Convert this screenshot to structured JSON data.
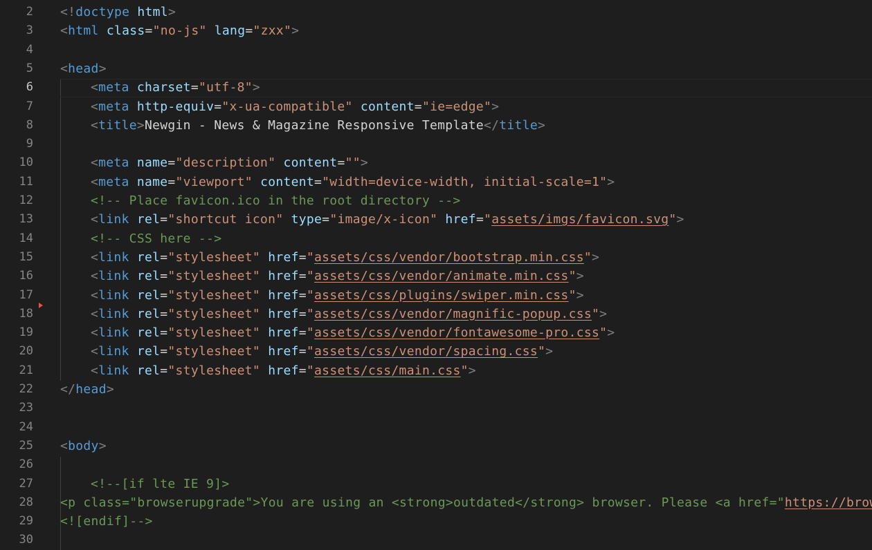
{
  "editor": {
    "theme_colors": {
      "background": "#1e1e1e",
      "line_number": "#858585",
      "tag": "#569cd6",
      "attribute": "#9cdcfe",
      "string": "#ce9178",
      "comment": "#6a9955",
      "text": "#d4d4d4",
      "punctuation": "#808080"
    },
    "active_line": 6,
    "lines": [
      {
        "n": "2",
        "indent": 0,
        "tokens": [
          [
            "p",
            "<!"
          ],
          [
            "t",
            "doctype"
          ],
          [
            "x",
            " "
          ],
          [
            "a",
            "html"
          ],
          [
            "p",
            ">"
          ]
        ]
      },
      {
        "n": "3",
        "indent": 0,
        "tokens": [
          [
            "p",
            "<"
          ],
          [
            "t",
            "html"
          ],
          [
            "x",
            " "
          ],
          [
            "a",
            "class"
          ],
          [
            "x",
            "="
          ],
          [
            "s",
            "\"no-js\""
          ],
          [
            "x",
            " "
          ],
          [
            "a",
            "lang"
          ],
          [
            "x",
            "="
          ],
          [
            "s",
            "\"zxx\""
          ],
          [
            "p",
            ">"
          ]
        ]
      },
      {
        "n": "4",
        "indent": 0,
        "tokens": []
      },
      {
        "n": "5",
        "indent": 0,
        "tokens": [
          [
            "p",
            "<"
          ],
          [
            "t",
            "head"
          ],
          [
            "p",
            ">"
          ]
        ]
      },
      {
        "n": "6",
        "indent": 1,
        "tokens": [
          [
            "p",
            "<"
          ],
          [
            "t",
            "meta"
          ],
          [
            "x",
            " "
          ],
          [
            "a",
            "charset"
          ],
          [
            "x",
            "="
          ],
          [
            "s",
            "\"utf-8\""
          ],
          [
            "p",
            ">"
          ]
        ]
      },
      {
        "n": "7",
        "indent": 1,
        "tokens": [
          [
            "p",
            "<"
          ],
          [
            "t",
            "meta"
          ],
          [
            "x",
            " "
          ],
          [
            "a",
            "http-equiv"
          ],
          [
            "x",
            "="
          ],
          [
            "s",
            "\"x-ua-compatible\""
          ],
          [
            "x",
            " "
          ],
          [
            "a",
            "content"
          ],
          [
            "x",
            "="
          ],
          [
            "s",
            "\"ie=edge\""
          ],
          [
            "p",
            ">"
          ]
        ]
      },
      {
        "n": "8",
        "indent": 1,
        "tokens": [
          [
            "p",
            "<"
          ],
          [
            "t",
            "title"
          ],
          [
            "p",
            ">"
          ],
          [
            "x",
            "Newgin - News & Magazine Responsive Template"
          ],
          [
            "p",
            "</"
          ],
          [
            "t",
            "title"
          ],
          [
            "p",
            ">"
          ]
        ]
      },
      {
        "n": "9",
        "indent": 1,
        "tokens": []
      },
      {
        "n": "10",
        "indent": 1,
        "tokens": [
          [
            "p",
            "<"
          ],
          [
            "t",
            "meta"
          ],
          [
            "x",
            " "
          ],
          [
            "a",
            "name"
          ],
          [
            "x",
            "="
          ],
          [
            "s",
            "\"description\""
          ],
          [
            "x",
            " "
          ],
          [
            "a",
            "content"
          ],
          [
            "x",
            "="
          ],
          [
            "s",
            "\"\""
          ],
          [
            "p",
            ">"
          ]
        ]
      },
      {
        "n": "11",
        "indent": 1,
        "tokens": [
          [
            "p",
            "<"
          ],
          [
            "t",
            "meta"
          ],
          [
            "x",
            " "
          ],
          [
            "a",
            "name"
          ],
          [
            "x",
            "="
          ],
          [
            "s",
            "\"viewport\""
          ],
          [
            "x",
            " "
          ],
          [
            "a",
            "content"
          ],
          [
            "x",
            "="
          ],
          [
            "s",
            "\"width=device-width, initial-scale=1\""
          ],
          [
            "p",
            ">"
          ]
        ]
      },
      {
        "n": "12",
        "indent": 1,
        "tokens": [
          [
            "c",
            "<!-- Place favicon.ico in the root directory -->"
          ]
        ]
      },
      {
        "n": "13",
        "indent": 1,
        "tokens": [
          [
            "p",
            "<"
          ],
          [
            "t",
            "link"
          ],
          [
            "x",
            " "
          ],
          [
            "a",
            "rel"
          ],
          [
            "x",
            "="
          ],
          [
            "s",
            "\"shortcut icon\""
          ],
          [
            "x",
            " "
          ],
          [
            "a",
            "type"
          ],
          [
            "x",
            "="
          ],
          [
            "s",
            "\"image/x-icon\""
          ],
          [
            "x",
            " "
          ],
          [
            "a",
            "href"
          ],
          [
            "x",
            "="
          ],
          [
            "s",
            "\""
          ],
          [
            "l",
            "assets/imgs/favicon.svg"
          ],
          [
            "s",
            "\""
          ],
          [
            "p",
            ">"
          ]
        ]
      },
      {
        "n": "14",
        "indent": 1,
        "tokens": [
          [
            "c",
            "<!-- CSS here -->"
          ]
        ]
      },
      {
        "n": "15",
        "indent": 1,
        "tokens": [
          [
            "p",
            "<"
          ],
          [
            "t",
            "link"
          ],
          [
            "x",
            " "
          ],
          [
            "a",
            "rel"
          ],
          [
            "x",
            "="
          ],
          [
            "s",
            "\"stylesheet\""
          ],
          [
            "x",
            " "
          ],
          [
            "a",
            "href"
          ],
          [
            "x",
            "="
          ],
          [
            "s",
            "\""
          ],
          [
            "l",
            "assets/css/vendor/bootstrap.min.css"
          ],
          [
            "s",
            "\""
          ],
          [
            "p",
            ">"
          ]
        ]
      },
      {
        "n": "16",
        "indent": 1,
        "tokens": [
          [
            "p",
            "<"
          ],
          [
            "t",
            "link"
          ],
          [
            "x",
            " "
          ],
          [
            "a",
            "rel"
          ],
          [
            "x",
            "="
          ],
          [
            "s",
            "\"stylesheet\""
          ],
          [
            "x",
            " "
          ],
          [
            "a",
            "href"
          ],
          [
            "x",
            "="
          ],
          [
            "s",
            "\""
          ],
          [
            "l",
            "assets/css/vendor/animate.min.css"
          ],
          [
            "s",
            "\""
          ],
          [
            "p",
            ">"
          ]
        ]
      },
      {
        "n": "17",
        "indent": 1,
        "tokens": [
          [
            "p",
            "<"
          ],
          [
            "t",
            "link"
          ],
          [
            "x",
            " "
          ],
          [
            "a",
            "rel"
          ],
          [
            "x",
            "="
          ],
          [
            "s",
            "\"stylesheet\""
          ],
          [
            "x",
            " "
          ],
          [
            "a",
            "href"
          ],
          [
            "x",
            "="
          ],
          [
            "s",
            "\""
          ],
          [
            "l",
            "assets/css/plugins/swiper.min.css"
          ],
          [
            "s",
            "\""
          ],
          [
            "p",
            ">"
          ]
        ]
      },
      {
        "n": "18",
        "indent": 1,
        "tokens": [
          [
            "p",
            "<"
          ],
          [
            "t",
            "link"
          ],
          [
            "x",
            " "
          ],
          [
            "a",
            "rel"
          ],
          [
            "x",
            "="
          ],
          [
            "s",
            "\"stylesheet\""
          ],
          [
            "x",
            " "
          ],
          [
            "a",
            "href"
          ],
          [
            "x",
            "="
          ],
          [
            "s",
            "\""
          ],
          [
            "l",
            "assets/css/vendor/magnific-popup.css"
          ],
          [
            "s",
            "\""
          ],
          [
            "p",
            ">"
          ]
        ]
      },
      {
        "n": "19",
        "indent": 1,
        "tokens": [
          [
            "p",
            "<"
          ],
          [
            "t",
            "link"
          ],
          [
            "x",
            " "
          ],
          [
            "a",
            "rel"
          ],
          [
            "x",
            "="
          ],
          [
            "s",
            "\"stylesheet\""
          ],
          [
            "x",
            " "
          ],
          [
            "a",
            "href"
          ],
          [
            "x",
            "="
          ],
          [
            "s",
            "\""
          ],
          [
            "l",
            "assets/css/vendor/fontawesome-pro.css"
          ],
          [
            "s",
            "\""
          ],
          [
            "p",
            ">"
          ]
        ]
      },
      {
        "n": "20",
        "indent": 1,
        "tokens": [
          [
            "p",
            "<"
          ],
          [
            "t",
            "link"
          ],
          [
            "x",
            " "
          ],
          [
            "a",
            "rel"
          ],
          [
            "x",
            "="
          ],
          [
            "s",
            "\"stylesheet\""
          ],
          [
            "x",
            " "
          ],
          [
            "a",
            "href"
          ],
          [
            "x",
            "="
          ],
          [
            "s",
            "\""
          ],
          [
            "l",
            "assets/css/vendor/spacing.css"
          ],
          [
            "s",
            "\""
          ],
          [
            "p",
            ">"
          ]
        ]
      },
      {
        "n": "21",
        "indent": 1,
        "tokens": [
          [
            "p",
            "<"
          ],
          [
            "t",
            "link"
          ],
          [
            "x",
            " "
          ],
          [
            "a",
            "rel"
          ],
          [
            "x",
            "="
          ],
          [
            "s",
            "\"stylesheet\""
          ],
          [
            "x",
            " "
          ],
          [
            "a",
            "href"
          ],
          [
            "x",
            "="
          ],
          [
            "s",
            "\""
          ],
          [
            "l",
            "assets/css/main.css"
          ],
          [
            "s",
            "\""
          ],
          [
            "p",
            ">"
          ]
        ]
      },
      {
        "n": "22",
        "indent": 0,
        "tokens": [
          [
            "p",
            "</"
          ],
          [
            "t",
            "head"
          ],
          [
            "p",
            ">"
          ]
        ]
      },
      {
        "n": "23",
        "indent": 0,
        "tokens": []
      },
      {
        "n": "24",
        "indent": 0,
        "tokens": []
      },
      {
        "n": "25",
        "indent": 0,
        "tokens": [
          [
            "p",
            "<"
          ],
          [
            "t",
            "body"
          ],
          [
            "p",
            ">"
          ]
        ]
      },
      {
        "n": "26",
        "indent": 1,
        "tokens": []
      },
      {
        "n": "27",
        "indent": 1,
        "tokens": [
          [
            "c",
            "<!--[if lte IE 9]>"
          ]
        ]
      },
      {
        "n": "28",
        "indent": 0,
        "tokens": [
          [
            "c",
            "<p class=\"browserupgrade\">You are using an <strong>outdated</strong> browser. Please <a href=\""
          ],
          [
            "l",
            "https://brow"
          ]
        ]
      },
      {
        "n": "29",
        "indent": 0,
        "tokens": [
          [
            "c",
            "<![endif]-->"
          ]
        ]
      },
      {
        "n": "30",
        "indent": 1,
        "tokens": []
      }
    ]
  }
}
